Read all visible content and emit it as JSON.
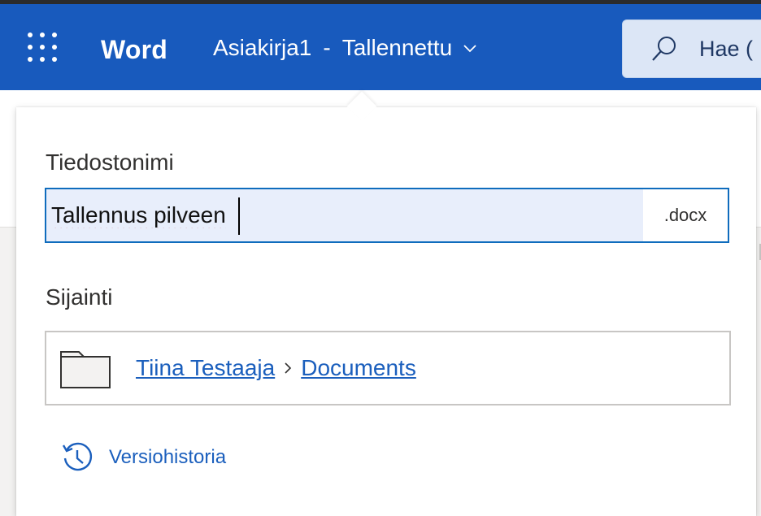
{
  "appbar": {
    "app_name": "Word",
    "doc_name": "Asiakirja1",
    "separator": "-",
    "save_status": "Tallennettu",
    "search_label": "Hae ("
  },
  "icons": {
    "launcher": "app-launcher-icon",
    "search": "search-icon",
    "chevron": "chevron-down-icon",
    "folder": "folder-icon",
    "breadcrumb_sep": "chevron-right-icon",
    "history": "history-icon"
  },
  "colors": {
    "brand": "#185abd",
    "link": "#1b5fbd",
    "focus_border": "#0f6cbd",
    "input_bg": "#e8eefb"
  },
  "callout": {
    "filename_label": "Tiedostonimi",
    "filename_value": "Tallennus pilveen",
    "extension": ".docx",
    "location_label": "Sijainti",
    "location_path": [
      "Tiina Testaaja",
      "Documents"
    ],
    "version_history": "Versiohistoria"
  }
}
